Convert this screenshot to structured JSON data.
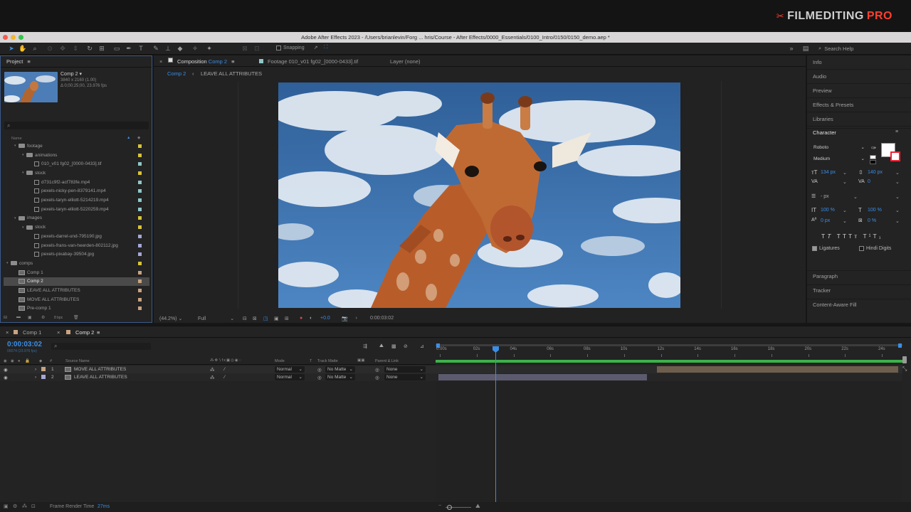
{
  "brand": {
    "film": "FILMEDITING",
    "pro": "PRO"
  },
  "window": {
    "title": "Adobe After Effects 2023 - /Users/brianlevin/Forg ... hris/Course - After Effects/0000_Essentials/0100_Intro/0150/0150_demo.aep *"
  },
  "toolbar": {
    "snapping_label": "Snapping",
    "search_placeholder": "Search Help"
  },
  "project": {
    "panel_title": "Project",
    "comp_name": "Comp 2 ▾",
    "comp_res": "3840 x 2160 (1.00)",
    "comp_dur": "Δ 0;00;25;00, 23.976 fps",
    "search_icon": "⌕",
    "col_name": "Name",
    "footer_bpc": "8 bpc",
    "items": [
      {
        "label": "footage",
        "level": 1,
        "kind": "folder",
        "color": "#d7c43a"
      },
      {
        "label": "animations",
        "level": 2,
        "kind": "folder",
        "color": "#d7c43a"
      },
      {
        "label": "010_v01 fg02_[0000-0433].tif",
        "level": 3,
        "kind": "file",
        "color": "#8fc7c8"
      },
      {
        "label": "stock",
        "level": 2,
        "kind": "folder",
        "color": "#d7c43a"
      },
      {
        "label": "d731c9f2-acf783fe.mp4",
        "level": 3,
        "kind": "file",
        "color": "#8fc7c8"
      },
      {
        "label": "pexels-nicky-pen-8379141.mp4",
        "level": 3,
        "kind": "file",
        "color": "#8fc7c8"
      },
      {
        "label": "pexels-taryn-elliott-5214219.mp4",
        "level": 3,
        "kind": "file",
        "color": "#8fc7c8"
      },
      {
        "label": "pexels-taryn-elliott-5220259.mp4",
        "level": 3,
        "kind": "file",
        "color": "#8fc7c8"
      },
      {
        "label": "images",
        "level": 1,
        "kind": "folder",
        "color": "#d7c43a"
      },
      {
        "label": "stock",
        "level": 2,
        "kind": "folder",
        "color": "#d7c43a"
      },
      {
        "label": "pexels-darrel-und-795190.jpg",
        "level": 3,
        "kind": "file",
        "color": "#a6a6d8"
      },
      {
        "label": "pexels-frans-van-heerden-802112.jpg",
        "level": 3,
        "kind": "file",
        "color": "#a6a6d8"
      },
      {
        "label": "pexels-pixabay-39504.jpg",
        "level": 3,
        "kind": "file",
        "color": "#a6a6d8"
      },
      {
        "label": "comps",
        "level": 0,
        "kind": "folder",
        "color": "#d7c43a"
      },
      {
        "label": "Comp 1",
        "level": 1,
        "kind": "comp",
        "color": "#c8a382"
      },
      {
        "label": "Comp 2",
        "level": 1,
        "kind": "comp",
        "color": "#c8a382",
        "selected": true
      },
      {
        "label": "LEAVE ALL ATTRIBUTES",
        "level": 1,
        "kind": "comp",
        "color": "#c8a382"
      },
      {
        "label": "MOVE ALL ATTRIBUTES",
        "level": 1,
        "kind": "comp",
        "color": "#c8a382"
      },
      {
        "label": "Pre-comp 1",
        "level": 1,
        "kind": "comp",
        "color": "#c8a382"
      }
    ]
  },
  "viewer": {
    "tab_comp_prefix": "Composition",
    "tab_comp_name": "Comp 2",
    "tab_footage": "Footage 010_v01 fg02_[0000-0433].tif",
    "tab_layer": "Layer (none)",
    "crumb_active": "Comp 2",
    "crumb_other": "LEAVE ALL ATTRIBUTES",
    "zoom": "(44.2%)",
    "resolution": "Full",
    "exposure": "+0.0",
    "current_time": "0:00:03:02"
  },
  "right_panel": {
    "items": [
      "Info",
      "Audio",
      "Preview",
      "Effects & Presets",
      "Libraries"
    ],
    "character_title": "Character",
    "font": "Roboto",
    "style": "Medium",
    "font_size": "134 px",
    "leading": "140 px",
    "kerning": "0",
    "stroke_unit": "- px",
    "vscale": "100 %",
    "hscale": "100 %",
    "baseline": "0 px",
    "tsume": "0 %",
    "ligatures": "Ligatures",
    "hindi": "Hindi Digits",
    "bottom_items": [
      "Paragraph",
      "Tracker",
      "Content-Aware Fill"
    ]
  },
  "timeline": {
    "tabs": [
      "Comp 1",
      "Comp 2"
    ],
    "timecode": "0:00:03:02",
    "timecode_sub": "00074 (23.976 fps)",
    "col_source": "Source Name",
    "col_mode": "Mode",
    "col_t": "T",
    "col_trackmatte": "Track Matte",
    "col_parent": "Parent & Link",
    "ruler_labels": [
      "0:00s",
      "02s",
      "04s",
      "06s",
      "08s",
      "10s",
      "12s",
      "14s",
      "16s",
      "18s",
      "20s",
      "22s",
      "24s"
    ],
    "layers": [
      {
        "num": "1",
        "name": "MOVE ALL ATTRIBUTES",
        "mode": "Normal",
        "matte": "No Matte",
        "parent": "None",
        "color": "#c8a382"
      },
      {
        "num": "2",
        "name": "LEAVE ALL ATTRIBUTES",
        "mode": "Normal",
        "matte": "No Matte",
        "parent": "None",
        "color": "#a6a6d8"
      }
    ]
  },
  "status": {
    "label": "Frame Render Time",
    "value": "27ms"
  }
}
